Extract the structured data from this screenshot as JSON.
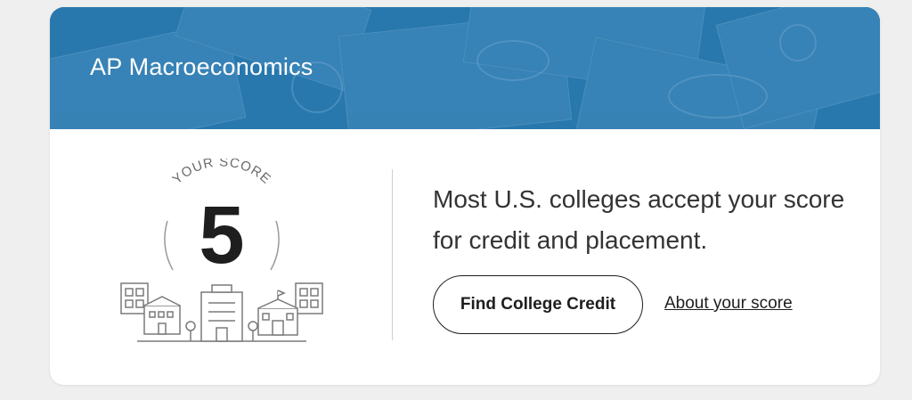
{
  "course": {
    "title": "AP Macroeconomics"
  },
  "score": {
    "caption": "YOUR SCORE",
    "value": "5"
  },
  "message": "Most U.S. colleges accept your score for credit and placement.",
  "actions": {
    "find_credit_label": "Find College Credit",
    "about_score_label": "About your score"
  },
  "colors": {
    "banner": "#2f7fb3",
    "text": "#1e1e1e"
  },
  "icons": [
    "currency-banknotes-background",
    "college-buildings-icon"
  ]
}
